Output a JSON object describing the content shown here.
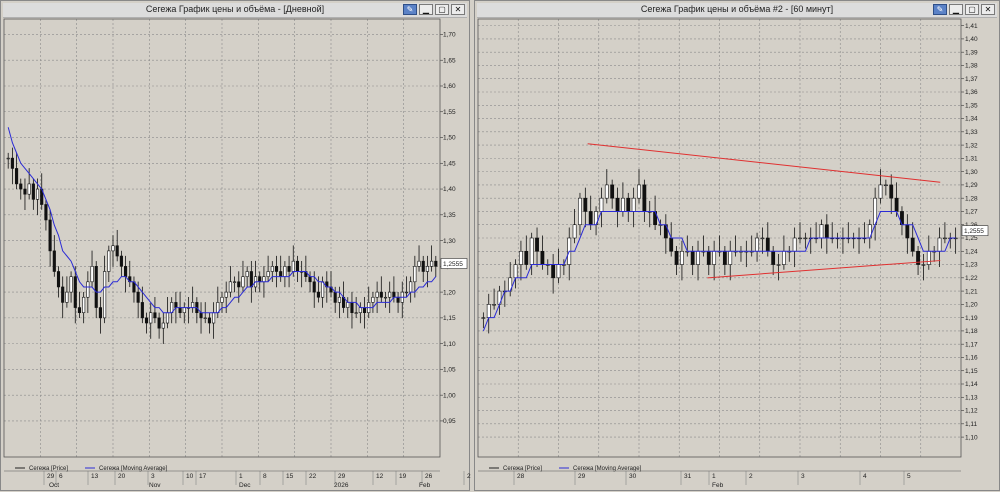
{
  "windows": [
    {
      "id": "left",
      "title": "Сегежа График цены и объёма - [Дневной]",
      "buttons": [
        "pin",
        "minimize",
        "maximize",
        "close"
      ],
      "legend": [
        {
          "label": "Сегежа [Price]",
          "color": "#222222"
        },
        {
          "label": "Сегежа [Moving Average]",
          "color": "#2b2bd6"
        }
      ],
      "price_label": "1,2555"
    },
    {
      "id": "right",
      "title": "Сегежа График цены и объёма #2 - [60 минут]",
      "buttons": [
        "pin",
        "minimize",
        "maximize",
        "close"
      ],
      "legend": [
        {
          "label": "Сегежа [Price]",
          "color": "#222222"
        },
        {
          "label": "Сегежа [Moving Average]",
          "color": "#2b2bd6"
        }
      ],
      "price_label": "1,2555"
    }
  ],
  "colors": {
    "bg": "#d4d0c8",
    "grid": "#8a8a8a",
    "price": "#111111",
    "ma": "#2b2bd6",
    "trendline": "#e03030",
    "price_marker_bg": "#ffffff"
  },
  "chart_data": [
    {
      "type": "candlestick",
      "window": "left",
      "ylim": [
        0.88,
        1.73
      ],
      "yticks": [
        "0,95",
        "1,00",
        "1,05",
        "1,10",
        "1,15",
        "1,20",
        "1,25",
        "1,30",
        "1,35",
        "1,40",
        "1,45",
        "1,50",
        "1,55",
        "1,60",
        "1,65",
        "1,70"
      ],
      "xticks_top": [
        "29",
        "6",
        "13",
        "20",
        "3",
        "10",
        "17",
        "1",
        "8",
        "15",
        "22",
        "29",
        "12",
        "19",
        "26",
        "2"
      ],
      "xticks_bottom": [
        "Oct",
        "Nov",
        "Dec",
        "2026",
        "Feb"
      ],
      "close": [
        1.46,
        1.44,
        1.41,
        1.4,
        1.39,
        1.41,
        1.38,
        1.4,
        1.37,
        1.34,
        1.28,
        1.24,
        1.21,
        1.18,
        1.2,
        1.23,
        1.17,
        1.16,
        1.19,
        1.22,
        1.25,
        1.17,
        1.15,
        1.24,
        1.28,
        1.29,
        1.27,
        1.25,
        1.23,
        1.22,
        1.2,
        1.18,
        1.15,
        1.14,
        1.16,
        1.15,
        1.13,
        1.14,
        1.16,
        1.18,
        1.17,
        1.16,
        1.17,
        1.17,
        1.18,
        1.16,
        1.15,
        1.15,
        1.14,
        1.16,
        1.18,
        1.19,
        1.2,
        1.22,
        1.22,
        1.21,
        1.23,
        1.24,
        1.21,
        1.23,
        1.22,
        1.23,
        1.24,
        1.25,
        1.24,
        1.23,
        1.25,
        1.24,
        1.26,
        1.24,
        1.24,
        1.23,
        1.22,
        1.2,
        1.19,
        1.22,
        1.21,
        1.2,
        1.18,
        1.19,
        1.17,
        1.18,
        1.16,
        1.16,
        1.17,
        1.16,
        1.18,
        1.19,
        1.2,
        1.19,
        1.19,
        1.2,
        1.19,
        1.18,
        1.2,
        1.2,
        1.22,
        1.25,
        1.26,
        1.24,
        1.25,
        1.26,
        1.25
      ],
      "ma": [
        1.52,
        1.49,
        1.47,
        1.45,
        1.44,
        1.43,
        1.42,
        1.41,
        1.4,
        1.38,
        1.36,
        1.33,
        1.31,
        1.28,
        1.27,
        1.26,
        1.24,
        1.22,
        1.21,
        1.21,
        1.21,
        1.2,
        1.2,
        1.21,
        1.21,
        1.22,
        1.22,
        1.23,
        1.23,
        1.22,
        1.22,
        1.21,
        1.2,
        1.19,
        1.18,
        1.17,
        1.17,
        1.16,
        1.16,
        1.16,
        1.17,
        1.17,
        1.17,
        1.17,
        1.17,
        1.17,
        1.16,
        1.16,
        1.16,
        1.16,
        1.16,
        1.17,
        1.17,
        1.18,
        1.19,
        1.19,
        1.2,
        1.21,
        1.21,
        1.22,
        1.22,
        1.22,
        1.22,
        1.23,
        1.23,
        1.23,
        1.23,
        1.23,
        1.24,
        1.24,
        1.24,
        1.24,
        1.23,
        1.23,
        1.22,
        1.22,
        1.21,
        1.21,
        1.2,
        1.2,
        1.19,
        1.18,
        1.18,
        1.18,
        1.17,
        1.17,
        1.17,
        1.17,
        1.18,
        1.18,
        1.18,
        1.18,
        1.19,
        1.19,
        1.19,
        1.19,
        1.2,
        1.2,
        1.21,
        1.21,
        1.22,
        1.22,
        1.23
      ]
    },
    {
      "type": "candlestick",
      "window": "right",
      "ylim": [
        1.085,
        1.415
      ],
      "yticks": [
        "1,10",
        "1,11",
        "1,12",
        "1,13",
        "1,14",
        "1,15",
        "1,16",
        "1,17",
        "1,18",
        "1,19",
        "1,20",
        "1,21",
        "1,22",
        "1,23",
        "1,24",
        "1,25",
        "1,26",
        "1,27",
        "1,28",
        "1,29",
        "1,30",
        "1,31",
        "1,32",
        "1,33",
        "1,34",
        "1,35",
        "1,36",
        "1,37",
        "1,38",
        "1,39",
        "1,40",
        "1,41"
      ],
      "xticks_top": [
        "28",
        "29",
        "30",
        "31",
        "1",
        "2",
        "3",
        "4",
        "5"
      ],
      "xticks_bottom": [
        "Feb"
      ],
      "close": [
        1.19,
        1.2,
        1.2,
        1.21,
        1.21,
        1.22,
        1.23,
        1.24,
        1.23,
        1.25,
        1.24,
        1.23,
        1.23,
        1.22,
        1.23,
        1.23,
        1.25,
        1.26,
        1.28,
        1.27,
        1.26,
        1.27,
        1.28,
        1.29,
        1.28,
        1.27,
        1.28,
        1.27,
        1.28,
        1.29,
        1.27,
        1.27,
        1.26,
        1.26,
        1.25,
        1.24,
        1.23,
        1.24,
        1.24,
        1.23,
        1.24,
        1.24,
        1.23,
        1.24,
        1.24,
        1.23,
        1.24,
        1.24,
        1.24,
        1.24,
        1.24,
        1.25,
        1.25,
        1.24,
        1.23,
        1.23,
        1.24,
        1.24,
        1.25,
        1.25,
        1.25,
        1.25,
        1.25,
        1.26,
        1.25,
        1.25,
        1.25,
        1.25,
        1.25,
        1.25,
        1.25,
        1.25,
        1.26,
        1.28,
        1.29,
        1.29,
        1.28,
        1.27,
        1.26,
        1.25,
        1.24,
        1.23,
        1.23,
        1.24,
        1.24,
        1.25,
        1.25,
        1.25,
        1.25
      ],
      "ma": [
        1.18,
        1.19,
        1.19,
        1.2,
        1.21,
        1.21,
        1.22,
        1.22,
        1.22,
        1.23,
        1.23,
        1.23,
        1.23,
        1.23,
        1.23,
        1.23,
        1.24,
        1.24,
        1.25,
        1.26,
        1.26,
        1.26,
        1.27,
        1.27,
        1.27,
        1.27,
        1.27,
        1.27,
        1.27,
        1.27,
        1.27,
        1.27,
        1.27,
        1.26,
        1.26,
        1.25,
        1.25,
        1.25,
        1.24,
        1.24,
        1.24,
        1.24,
        1.24,
        1.24,
        1.24,
        1.24,
        1.24,
        1.24,
        1.24,
        1.24,
        1.24,
        1.24,
        1.24,
        1.24,
        1.24,
        1.24,
        1.24,
        1.24,
        1.24,
        1.24,
        1.24,
        1.25,
        1.25,
        1.25,
        1.25,
        1.25,
        1.25,
        1.25,
        1.25,
        1.25,
        1.25,
        1.25,
        1.25,
        1.26,
        1.27,
        1.27,
        1.27,
        1.27,
        1.26,
        1.26,
        1.26,
        1.25,
        1.24,
        1.24,
        1.24,
        1.24,
        1.24,
        1.25,
        1.25
      ],
      "trendlines": [
        {
          "from": [
            0.227,
            1.321
          ],
          "to": [
            0.957,
            1.292
          ]
        },
        {
          "from": [
            0.475,
            1.22
          ],
          "to": [
            0.957,
            1.233
          ]
        }
      ]
    }
  ]
}
